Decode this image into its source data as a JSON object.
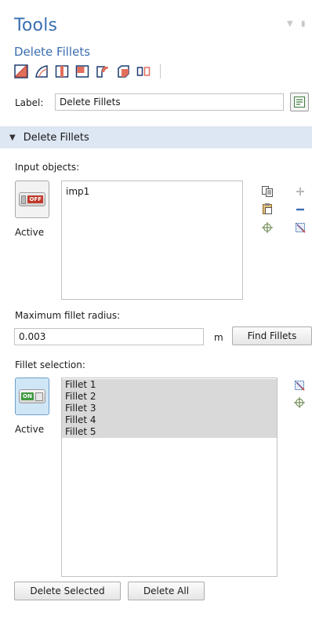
{
  "panel": {
    "title": "Tools",
    "subtitle": "Delete Fillets"
  },
  "toolbar": {
    "icons": [
      "select-objects-icon",
      "select-faces-icon",
      "select-edges-icon",
      "select-points-icon",
      "fillet-icon",
      "delete-face-icon",
      "split-icon"
    ]
  },
  "label_row": {
    "label": "Label:",
    "value": "Delete Fillets"
  },
  "section": {
    "title": "Delete Fillets"
  },
  "input_objects": {
    "label": "Input objects:",
    "toggle_text": "OFF",
    "active_label": "Active",
    "items": [
      "imp1"
    ]
  },
  "max_radius": {
    "label": "Maximum fillet radius:",
    "value": "0.003",
    "unit": "m",
    "find_button": "Find Fillets"
  },
  "fillet_selection": {
    "label": "Fillet selection:",
    "toggle_text": "ON",
    "active_label": "Active",
    "items": [
      "Fillet 1",
      "Fillet 2",
      "Fillet 3",
      "Fillet 4",
      "Fillet 5"
    ]
  },
  "buttons": {
    "delete_selected": "Delete Selected",
    "delete_all": "Delete All"
  },
  "colors": {
    "accent": "#3a6fb0",
    "section_bg": "#dde6f3",
    "selection_bg": "#d9d9d9"
  }
}
